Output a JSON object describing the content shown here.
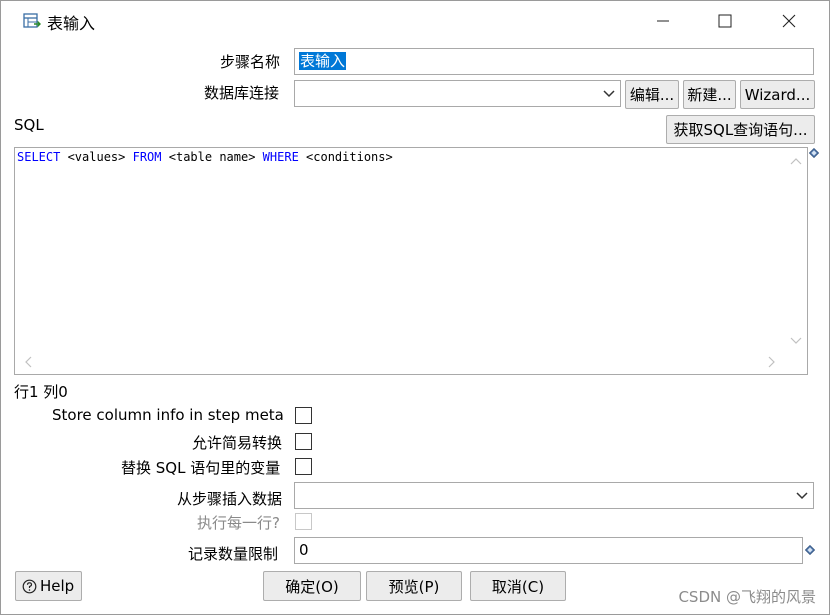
{
  "window": {
    "title": "表输入",
    "controls": {
      "minimize": "—",
      "maximize": "☐",
      "close": "✕"
    }
  },
  "form": {
    "step_name_label": "步骤名称",
    "step_name_value": "表输入",
    "db_conn_label": "数据库连接",
    "db_conn_value": "",
    "edit_button": "编辑...",
    "new_button": "新建...",
    "wizard_button": "Wizard...",
    "sql_label": "SQL",
    "get_sql_button": "获取SQL查询语句...",
    "sql": {
      "kw1": "SELECT",
      "t1": " <values> ",
      "kw2": "FROM",
      "t2": " <table name> ",
      "kw3": "WHERE",
      "t3": " <conditions>"
    },
    "cursor_position": "行1 列0",
    "store_column_label": "Store column info in step meta",
    "lazy_conversion_label": "允许简易转换",
    "replace_variables_label": "替换 SQL 语句里的变量",
    "insert_from_step_label": "从步骤插入数据",
    "insert_from_step_value": "",
    "execute_each_row_label": "执行每一行?",
    "limit_label": "记录数量限制",
    "limit_value": "0"
  },
  "footer": {
    "help_button": "Help",
    "ok_button": "确定(O)",
    "preview_button": "预览(P)",
    "cancel_button": "取消(C)"
  },
  "watermark": "CSDN @飞翔的风景"
}
